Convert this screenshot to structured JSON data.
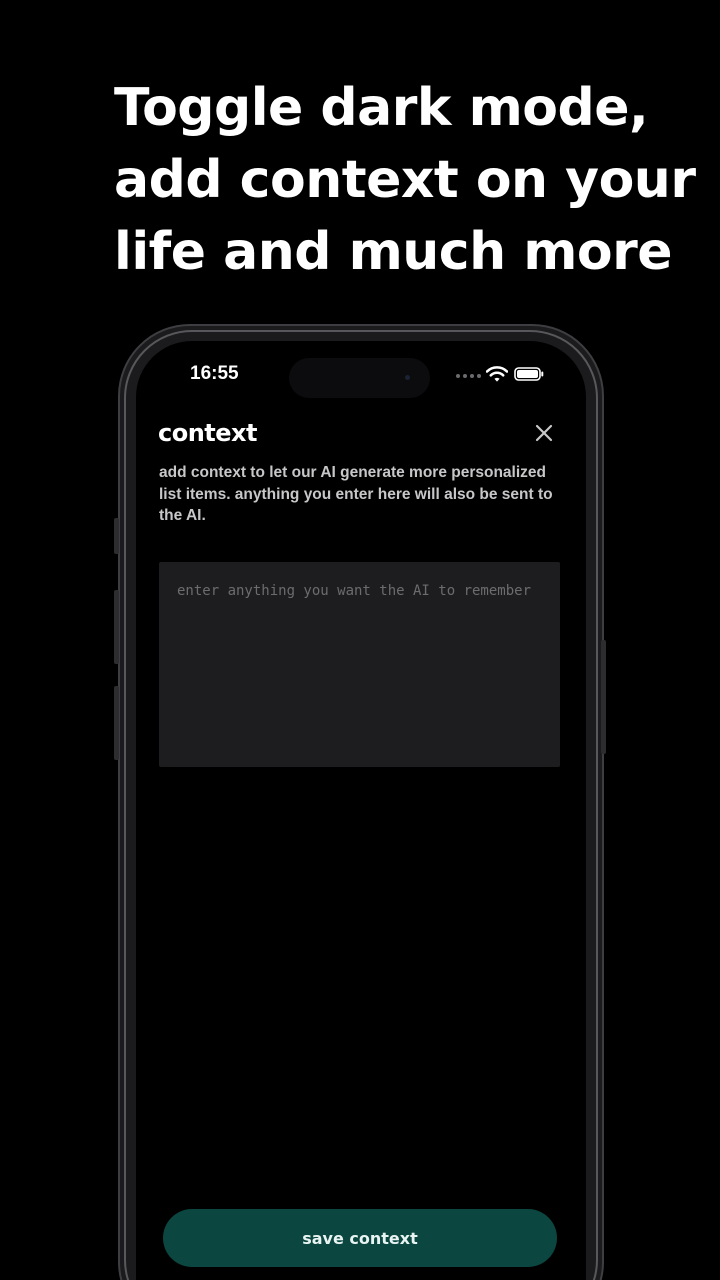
{
  "headline": {
    "line1": "Toggle dark mode,",
    "line2": "add context on your",
    "line3": "life and much more"
  },
  "status_bar": {
    "time": "16:55",
    "icons": [
      "signal-dots-icon",
      "wifi-icon",
      "battery-icon"
    ]
  },
  "sheet": {
    "title": "context",
    "description": "add context to let our AI generate more personalized list items. anything you enter here will also be sent to the AI.",
    "close_icon": "close-icon",
    "input": {
      "value": "",
      "placeholder": "enter anything you want the AI to remember"
    },
    "save_label": "save context"
  },
  "colors": {
    "background": "#000000",
    "input_background": "#1d1d1f",
    "accent": "#0c4640",
    "caret": "#2f8f82"
  }
}
